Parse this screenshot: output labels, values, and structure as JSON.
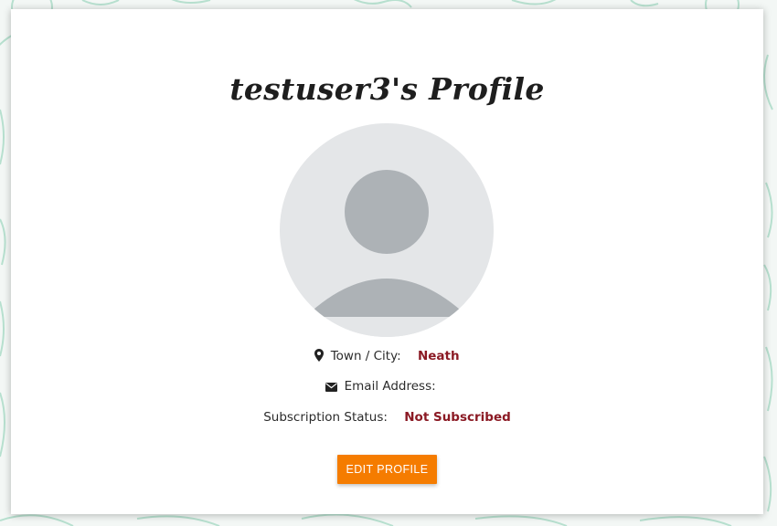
{
  "colors": {
    "background_pattern": "#a8d8c5",
    "avatar_bg": "#e4e6e8",
    "avatar_figure": "#adb2b6",
    "value_accent": "#8b1a24",
    "button_bg": "#f57c00"
  },
  "profile": {
    "title": "testuser3's Profile",
    "town_label": "Town / City:",
    "town_value": "Neath",
    "email_label": "Email Address:",
    "email_value": "",
    "subscription_label": "Subscription Status:",
    "subscription_value": "Not Subscribed",
    "edit_button": "EDIT PROFILE"
  },
  "icons": {
    "town": "map-marker-icon",
    "email": "envelope-icon",
    "avatar": "default-user-avatar"
  }
}
